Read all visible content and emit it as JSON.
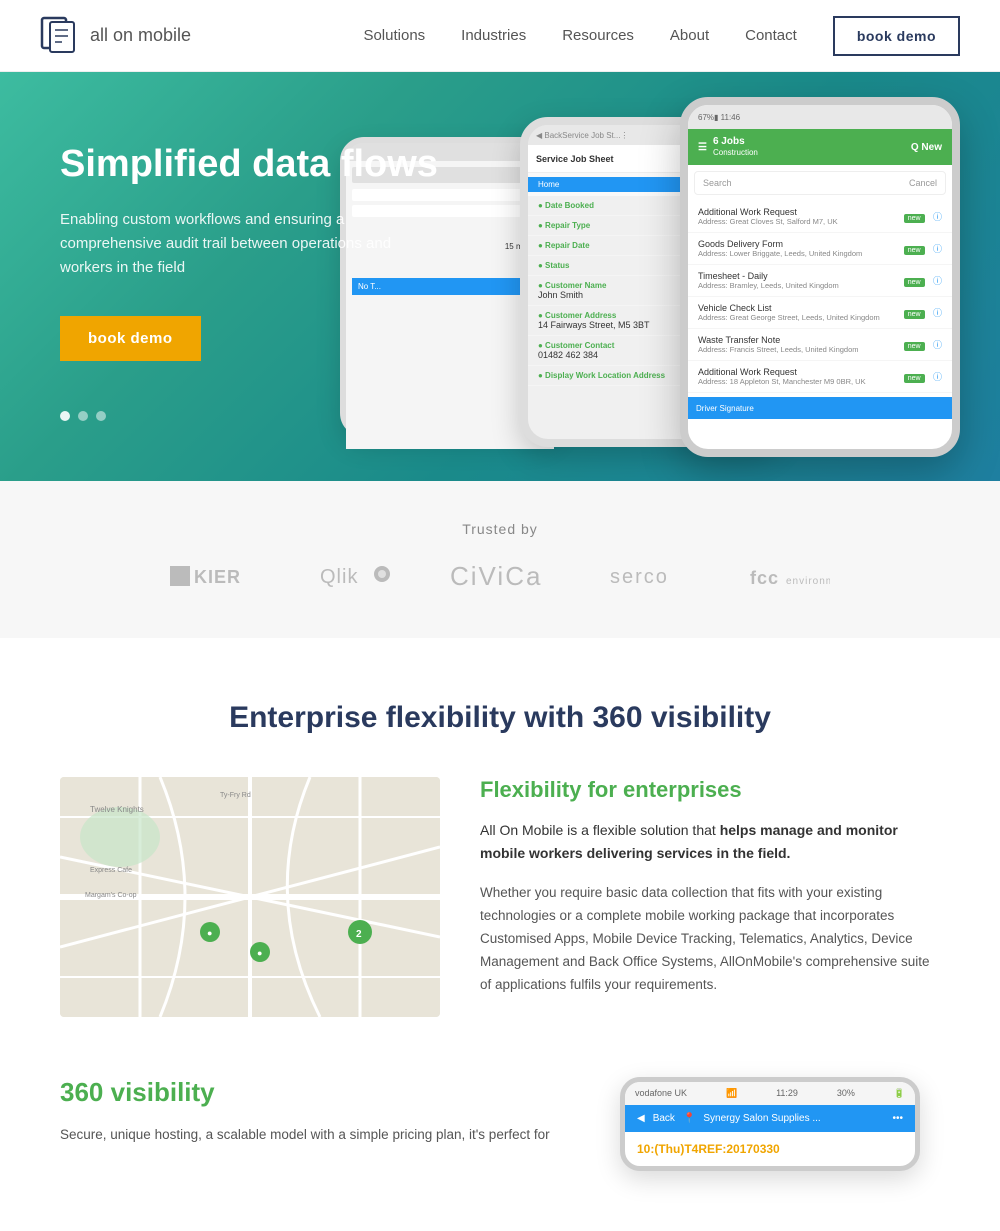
{
  "navbar": {
    "logo_text": "all on mobile",
    "links": [
      {
        "label": "Solutions",
        "id": "solutions"
      },
      {
        "label": "Industries",
        "id": "industries"
      },
      {
        "label": "Resources",
        "id": "resources"
      },
      {
        "label": "About",
        "id": "about"
      },
      {
        "label": "Contact",
        "id": "contact"
      }
    ],
    "book_demo_label": "book demo"
  },
  "hero": {
    "headline": "Simplified data flows",
    "body": "Enabling custom workflows and ensuring a comprehensive audit trail between operations and workers in the field",
    "cta_label": "book demo",
    "phone_front": {
      "header_text": "6 Jobs",
      "sub_header": "Construction",
      "search_placeholder": "Search",
      "cancel_label": "Cancel",
      "items": [
        {
          "title": "Additional Work Request",
          "address": "Address: Great Cloves St, Salford M7, UK",
          "badge": "new"
        },
        {
          "title": "Goods Delivery Form",
          "address": "Address: Lower Briggate, Leeds, United Kingdom",
          "badge": "new"
        },
        {
          "title": "Timesheet - Daily",
          "address": "Address: Bramley, Leeds, United Kingdom",
          "badge": "new"
        },
        {
          "title": "Vehicle Check List",
          "address": "Address: Great George Street, Leeds, United Kingdom",
          "badge": "new"
        },
        {
          "title": "Waste Transfer Note",
          "address": "Address: Francis Street, Leeds, United Kingdom",
          "badge": "new"
        },
        {
          "title": "Additional Work Request",
          "address": "Address: 18 Appleton St, Manchester M9 0BR, UK",
          "badge": "new"
        }
      ]
    },
    "phone_back": {
      "title": "Service Job Sheet",
      "fields": [
        {
          "label": "Date Booked",
          "value": ""
        },
        {
          "label": "Repair Type",
          "value": ""
        },
        {
          "label": "Repair Date",
          "value": ""
        },
        {
          "label": "Status",
          "value": ""
        },
        {
          "label": "Customer Name",
          "value": "John Smith"
        },
        {
          "label": "Customer Address",
          "value": "14 Fairways Street, M5 3BT"
        },
        {
          "label": "Customer Contact",
          "value": "01482 462 384"
        }
      ]
    }
  },
  "trusted": {
    "title": "Trusted by",
    "logos": [
      "KIER",
      "Qlik",
      "CiViCa",
      "serco",
      "fcc"
    ]
  },
  "section2": {
    "title": "Enterprise flexibility with 360 visibility",
    "heading": "Flexibility for enterprises",
    "intro": "All On Mobile is a flexible solution that helps manage and monitor mobile workers delivering services in the field.",
    "body": "Whether you require basic data collection that fits with your existing technologies or a complete mobile working package that incorporates Customised Apps, Mobile Device Tracking, Telematics, Analytics, Device Management and Back Office Systems, AllOnMobile's comprehensive suite of applications fulfils your requirements."
  },
  "section3": {
    "heading": "360 visibility",
    "body": "Secure, unique hosting, a scalable model with a simple pricing plan, it's perfect for",
    "phone": {
      "carrier": "vodafone UK",
      "time": "11:29",
      "battery": "30%",
      "back_label": "Back",
      "location_name": "Synergy Salon Supplies ...",
      "ref": "10:(Thu)T4REF:20170330"
    }
  }
}
